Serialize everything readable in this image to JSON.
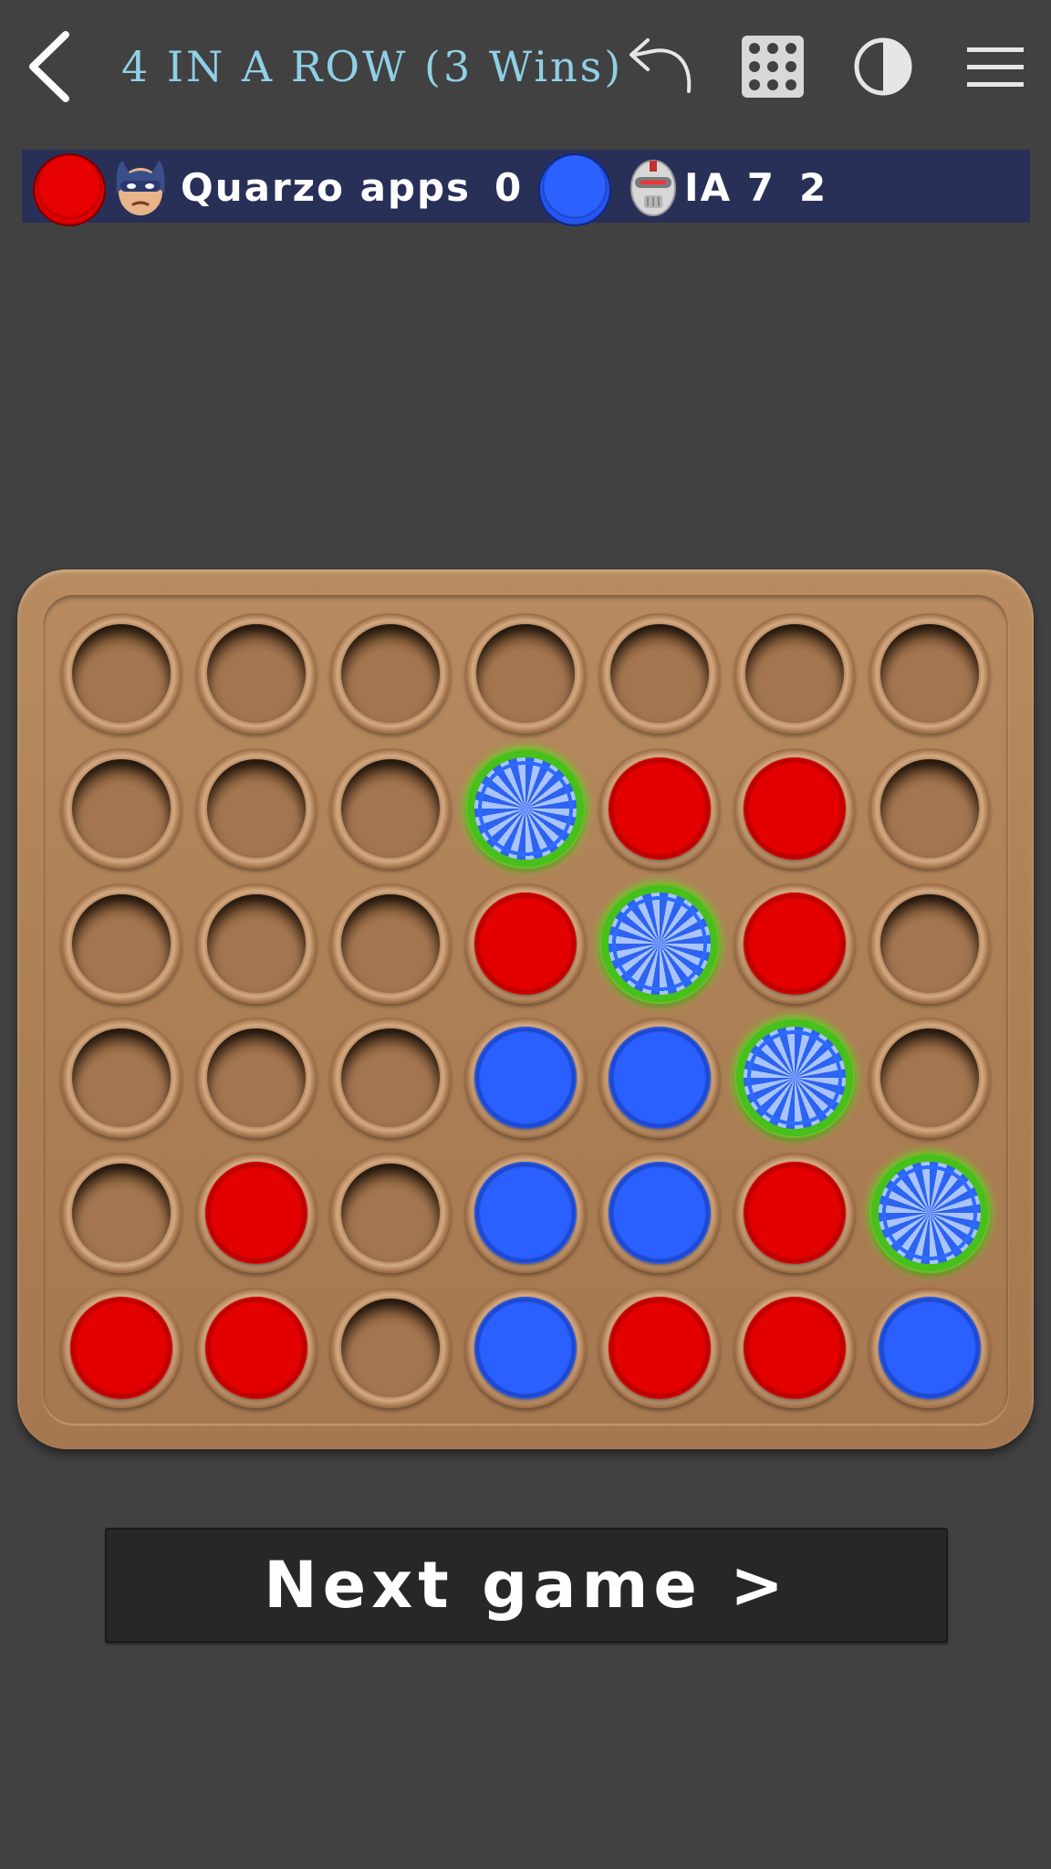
{
  "header": {
    "title": "4 IN A ROW (3 Wins)",
    "icons": [
      "back-arrow-icon",
      "undo-icon",
      "grid-icon",
      "contrast-icon",
      "menu-icon"
    ]
  },
  "scoreboard": {
    "player1": {
      "color": "red",
      "avatar": "masked-hero-avatar",
      "name": "Quarzo apps",
      "score": "0"
    },
    "player2": {
      "color": "blue",
      "avatar": "robot-avatar",
      "name": "IA 7",
      "score": "2"
    }
  },
  "board": {
    "columns": 7,
    "rows": 6,
    "cells": [
      [
        "",
        "",
        "",
        "",
        "",
        "",
        ""
      ],
      [
        "",
        "",
        "",
        "B*",
        "R",
        "R",
        ""
      ],
      [
        "",
        "",
        "",
        "R",
        "B*",
        "R",
        ""
      ],
      [
        "",
        "",
        "",
        "B",
        "B",
        "B*",
        ""
      ],
      [
        "",
        "R",
        "",
        "B",
        "B",
        "R",
        "B*"
      ],
      [
        "R",
        "R",
        "",
        "B",
        "R",
        "R",
        "B"
      ]
    ],
    "legend": {
      "R": "red",
      "B": "blue",
      "*": "winning-highlight"
    },
    "colors": {
      "red": "#e00000",
      "blue": "#2a60ff",
      "highlight": "#46c01a",
      "wood": "#b0835a"
    }
  },
  "next_button": {
    "label": "Next game >"
  }
}
